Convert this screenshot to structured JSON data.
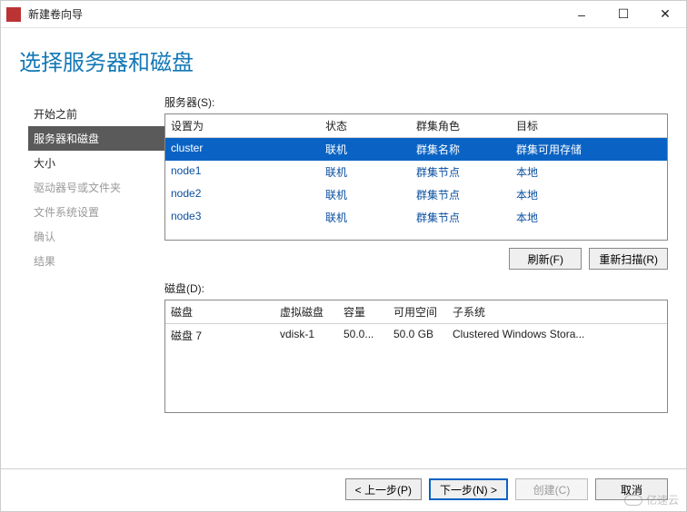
{
  "window": {
    "title": "新建卷向导"
  },
  "heading": "选择服务器和磁盘",
  "sidebar": {
    "items": [
      {
        "label": "开始之前",
        "enabled": true,
        "active": false
      },
      {
        "label": "服务器和磁盘",
        "enabled": true,
        "active": true
      },
      {
        "label": "大小",
        "enabled": true,
        "active": false
      },
      {
        "label": "驱动器号或文件夹",
        "enabled": false,
        "active": false
      },
      {
        "label": "文件系统设置",
        "enabled": false,
        "active": false
      },
      {
        "label": "确认",
        "enabled": false,
        "active": false
      },
      {
        "label": "结果",
        "enabled": false,
        "active": false
      }
    ]
  },
  "servers": {
    "label": "服务器(S):",
    "headers": [
      "设置为",
      "状态",
      "群集角色",
      "目标"
    ],
    "rows": [
      {
        "cols": [
          "cluster",
          "联机",
          "群集名称",
          "群集可用存储"
        ],
        "selected": true
      },
      {
        "cols": [
          "node1",
          "联机",
          "群集节点",
          "本地"
        ],
        "selected": false
      },
      {
        "cols": [
          "node2",
          "联机",
          "群集节点",
          "本地"
        ],
        "selected": false
      },
      {
        "cols": [
          "node3",
          "联机",
          "群集节点",
          "本地"
        ],
        "selected": false
      }
    ]
  },
  "buttons_mid": {
    "refresh": "刷新(F)",
    "rescan": "重新扫描(R)"
  },
  "disks": {
    "label": "磁盘(D):",
    "headers": [
      "磁盘",
      "虚拟磁盘",
      "容量",
      "可用空间",
      "子系统"
    ],
    "rows": [
      {
        "cols": [
          "磁盘 7",
          "vdisk-1",
          "50.0...",
          "50.0 GB",
          "Clustered Windows Stora..."
        ],
        "selected": false
      }
    ]
  },
  "footer": {
    "prev": "< 上一步(P)",
    "next": "下一步(N) >",
    "create": "创建(C)",
    "cancel": "取消"
  },
  "watermark": "亿速云"
}
